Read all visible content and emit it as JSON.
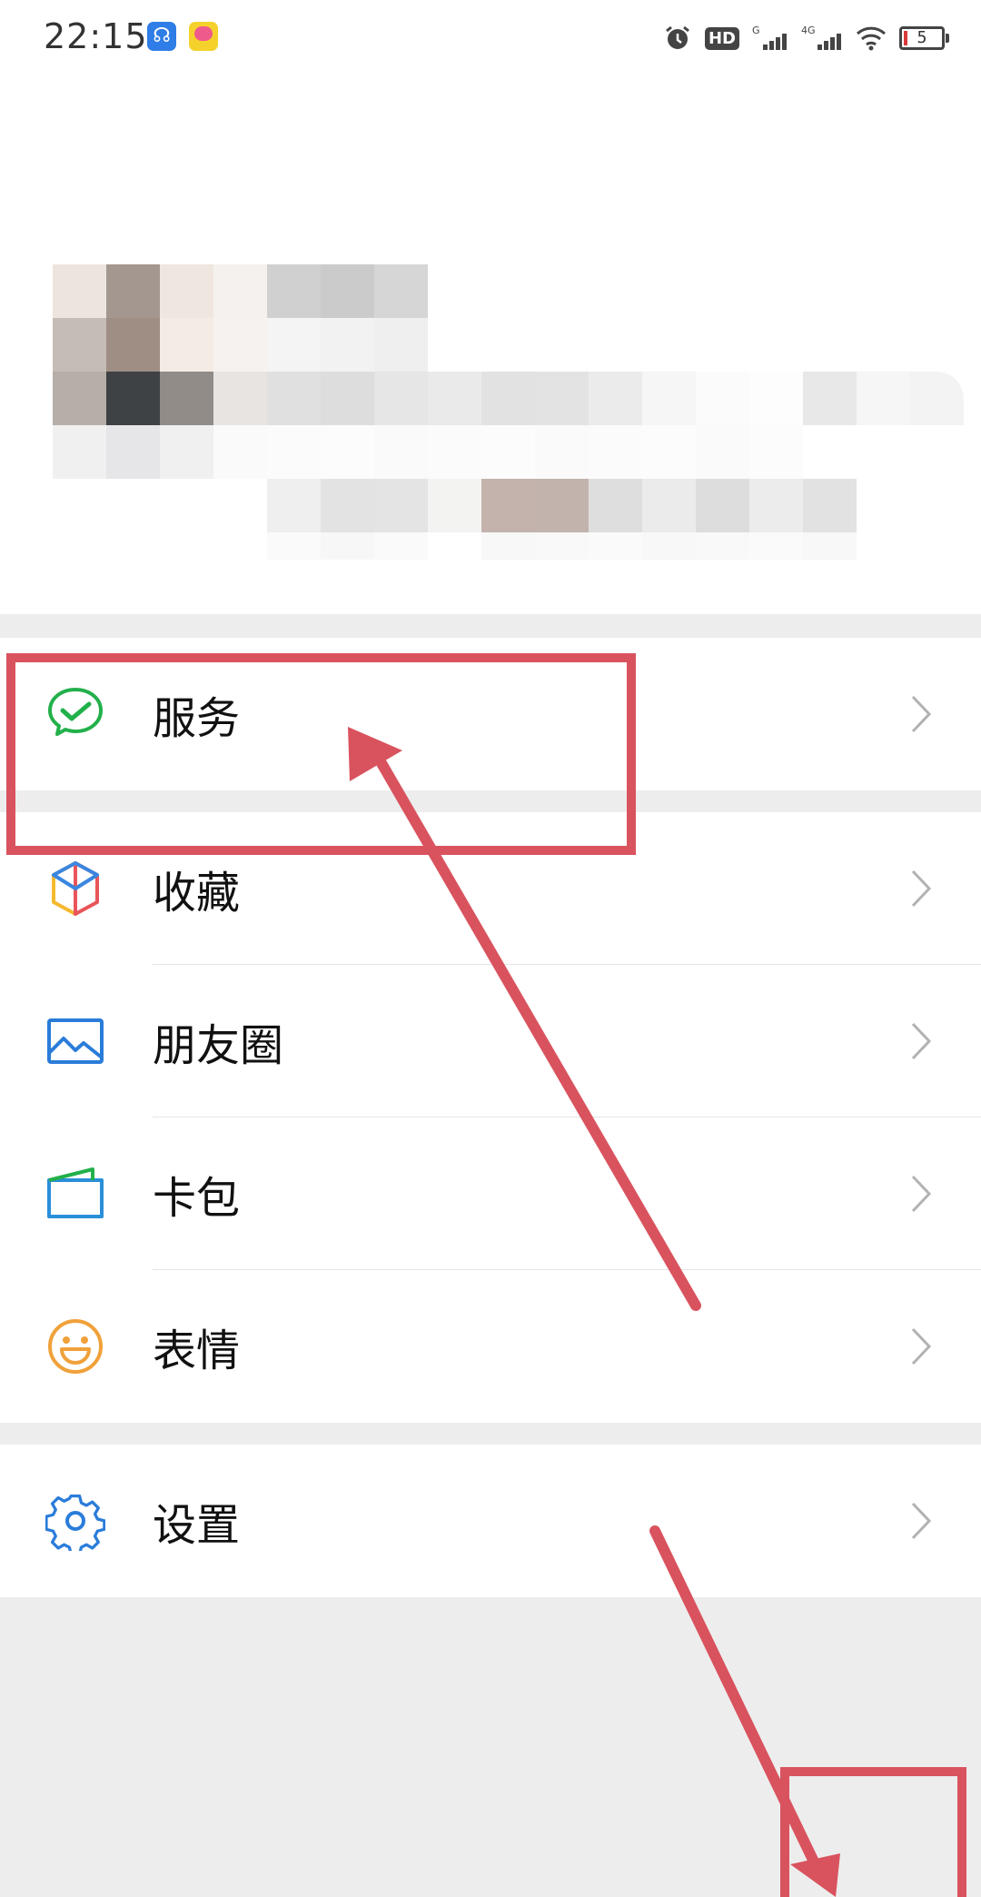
{
  "status_bar": {
    "time": "22:15",
    "battery_level": "5",
    "icons": [
      "alarm-icon",
      "hd-icon",
      "signal-icon",
      "signal-4g-icon",
      "wifi-icon",
      "battery-icon"
    ]
  },
  "menu": {
    "services": {
      "label": "服务",
      "icon": "wechat-pay-check-icon",
      "color": "#22b04b"
    },
    "favorites": {
      "label": "收藏",
      "icon": "cube-icon"
    },
    "moments": {
      "label": "朋友圈",
      "icon": "picture-icon",
      "color": "#2a7cd9"
    },
    "cards": {
      "label": "卡包",
      "icon": "wallet-icon",
      "color": "#2a8fd9"
    },
    "stickers": {
      "label": "表情",
      "icon": "smiley-icon",
      "color": "#f0a13a"
    },
    "settings": {
      "label": "设置",
      "icon": "gear-icon",
      "color": "#2a7cd9"
    }
  },
  "annotation": {
    "color": "#d9535e"
  }
}
